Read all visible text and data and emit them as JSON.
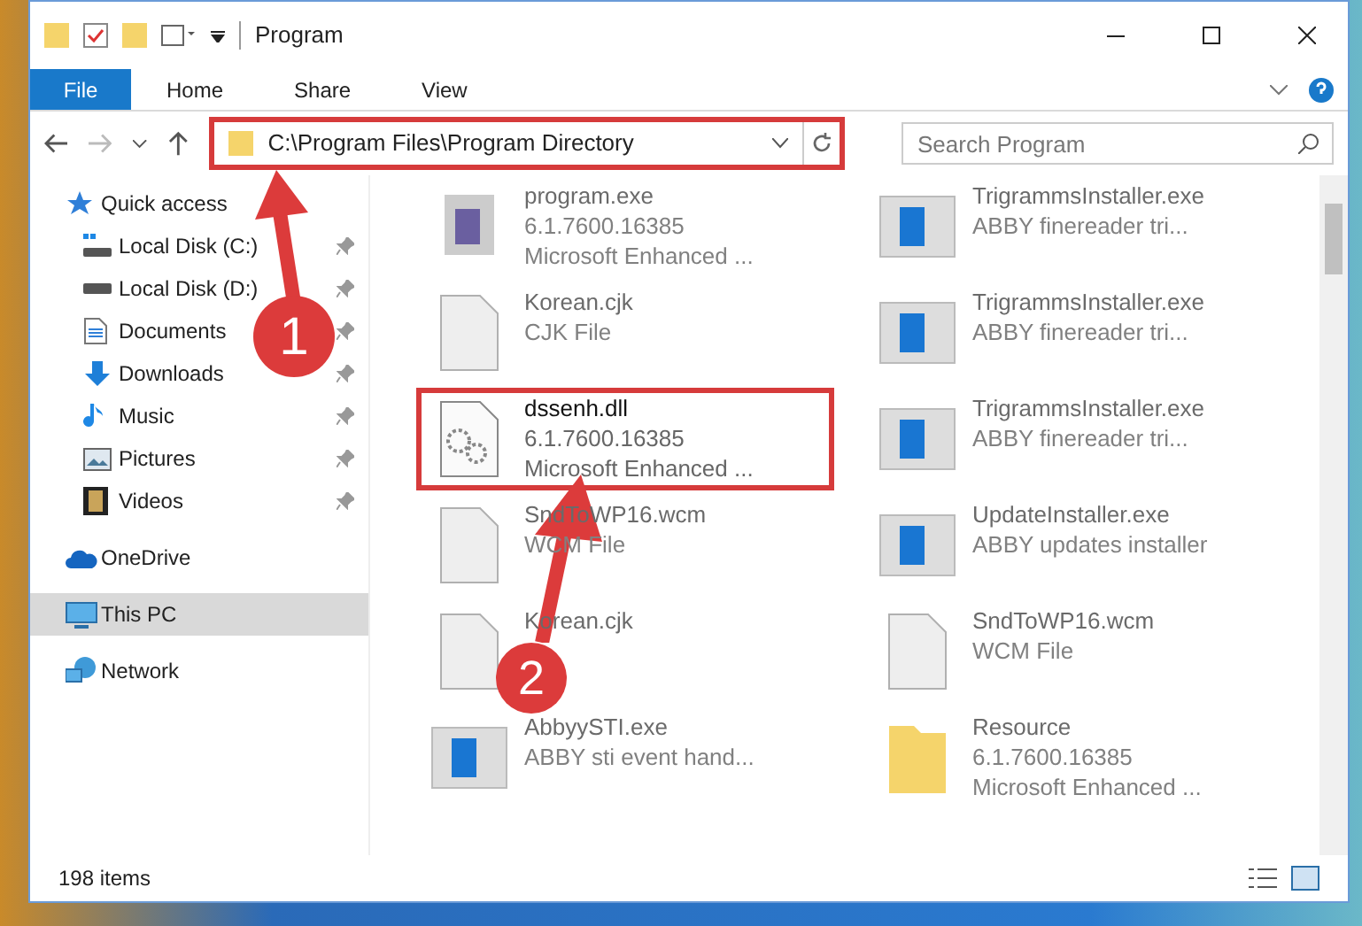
{
  "window": {
    "title": "Program"
  },
  "ribbon_tabs": [
    {
      "label": "File",
      "selected": true
    },
    {
      "label": "Home",
      "selected": false
    },
    {
      "label": "Share",
      "selected": false
    },
    {
      "label": "View",
      "selected": false
    }
  ],
  "address_bar": {
    "path": "C:\\Program Files\\Program Directory",
    "highlighted": true
  },
  "search": {
    "placeholder": "Search Program"
  },
  "sidebar": {
    "items": [
      {
        "label": "Quick access",
        "kind": "star",
        "selected": false,
        "pinned": false,
        "children": [
          {
            "label": "Local Disk (C:)",
            "kind": "drive-c",
            "selected": false,
            "pinned": true
          },
          {
            "label": "Local Disk (D:)",
            "kind": "drive",
            "selected": false,
            "pinned": true
          },
          {
            "label": "Documents",
            "kind": "docs",
            "selected": false,
            "pinned": true
          },
          {
            "label": "Downloads",
            "kind": "download",
            "selected": false,
            "pinned": true
          },
          {
            "label": "Music",
            "kind": "music",
            "selected": false,
            "pinned": true
          },
          {
            "label": "Pictures",
            "kind": "pictures",
            "selected": false,
            "pinned": true
          },
          {
            "label": "Videos",
            "kind": "videos",
            "selected": false,
            "pinned": true
          }
        ]
      },
      {
        "label": "OneDrive",
        "kind": "cloud",
        "selected": false,
        "pinned": false
      },
      {
        "label": "This PC",
        "kind": "pc",
        "selected": true,
        "pinned": false
      },
      {
        "label": "Network",
        "kind": "network",
        "selected": false,
        "pinned": false
      }
    ]
  },
  "files": [
    {
      "name": "program.exe",
      "lines": [
        "6.1.7600.16385",
        "Microsoft Enhanced ..."
      ],
      "kind": "exe",
      "dimmed": true,
      "highlighted": false
    },
    {
      "name": "TrigrammsInstaller.exe",
      "lines": [
        "ABBY finereader tri..."
      ],
      "kind": "app",
      "dimmed": true,
      "highlighted": false
    },
    {
      "name": "Korean.cjk",
      "lines": [
        "CJK File"
      ],
      "kind": "doc",
      "dimmed": true,
      "highlighted": false
    },
    {
      "name": "TrigrammsInstaller.exe",
      "lines": [
        "ABBY finereader tri..."
      ],
      "kind": "app",
      "dimmed": true,
      "highlighted": false
    },
    {
      "name": "dssenh.dll",
      "lines": [
        "6.1.7600.16385",
        "Microsoft Enhanced ..."
      ],
      "kind": "dll",
      "dimmed": false,
      "highlighted": true
    },
    {
      "name": "TrigrammsInstaller.exe",
      "lines": [
        "ABBY finereader tri..."
      ],
      "kind": "app",
      "dimmed": true,
      "highlighted": false
    },
    {
      "name": "SndToWP16.wcm",
      "lines": [
        "WCM File"
      ],
      "kind": "doc",
      "dimmed": true,
      "highlighted": false
    },
    {
      "name": "UpdateInstaller.exe",
      "lines": [
        "ABBY updates installer"
      ],
      "kind": "app",
      "dimmed": true,
      "highlighted": false
    },
    {
      "name": "Korean.cjk",
      "kind": "doc",
      "dimmed": true,
      "highlighted": false
    },
    {
      "name": "SndToWP16.wcm",
      "lines": [
        "WCM File"
      ],
      "kind": "doc",
      "dimmed": true,
      "highlighted": false
    },
    {
      "name": "AbbyySTI.exe",
      "lines": [
        "ABBY sti event hand..."
      ],
      "kind": "app",
      "dimmed": true,
      "highlighted": false
    },
    {
      "name": "Resource",
      "lines": [
        "6.1.7600.16385",
        "Microsoft Enhanced ..."
      ],
      "kind": "folder",
      "dimmed": true,
      "highlighted": false
    }
  ],
  "status_bar": {
    "count": "198 items"
  },
  "annotations": [
    {
      "number": "1"
    },
    {
      "number": "2"
    }
  ]
}
